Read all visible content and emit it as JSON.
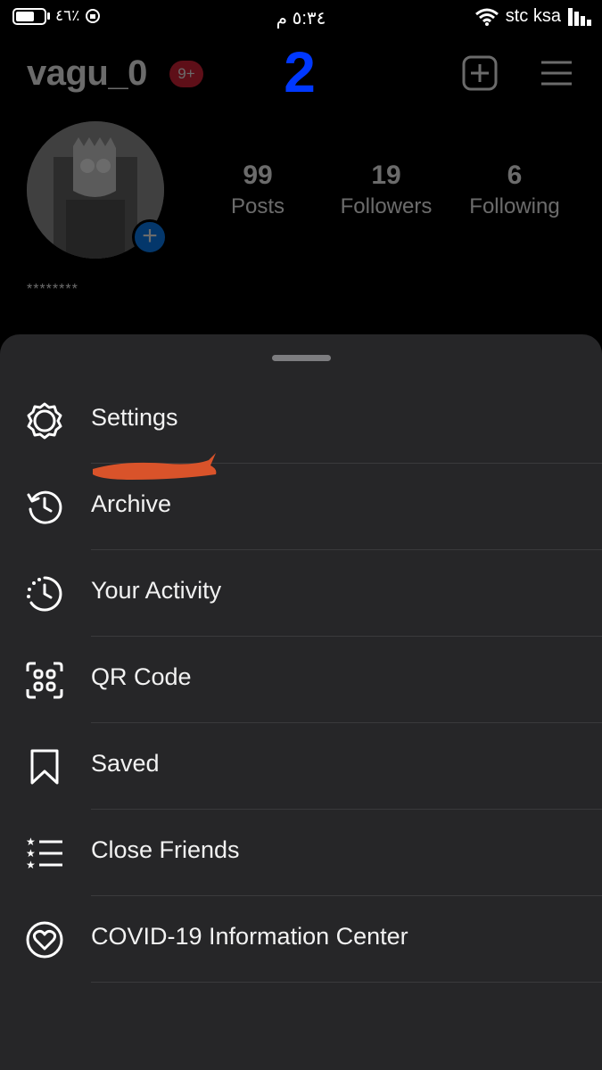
{
  "status_bar": {
    "battery_percent": "٤٦٪",
    "time": "٥:٣٤ م",
    "carrier": "stc ksa"
  },
  "profile": {
    "username": "vagu_0",
    "notification_badge": "9+",
    "stats": [
      {
        "value": "99",
        "label": "Posts"
      },
      {
        "value": "19",
        "label": "Followers"
      },
      {
        "value": "6",
        "label": "Following"
      }
    ],
    "bio": "********"
  },
  "annotation": {
    "step_number": "2",
    "step_color": "#0038ff",
    "highlight_color": "#d9532a"
  },
  "menu": {
    "items": [
      {
        "label": "Settings",
        "icon": "gear-icon"
      },
      {
        "label": "Archive",
        "icon": "archive-clock-icon"
      },
      {
        "label": "Your Activity",
        "icon": "activity-clock-icon"
      },
      {
        "label": "QR Code",
        "icon": "qr-code-icon"
      },
      {
        "label": "Saved",
        "icon": "bookmark-icon"
      },
      {
        "label": "Close Friends",
        "icon": "close-friends-list-icon"
      },
      {
        "label": "COVID-19 Information Center",
        "icon": "covid-heart-icon"
      }
    ]
  },
  "colors": {
    "sheet_background": "#262628",
    "badge_red": "#e0243a",
    "story_blue": "#0a84ff"
  }
}
